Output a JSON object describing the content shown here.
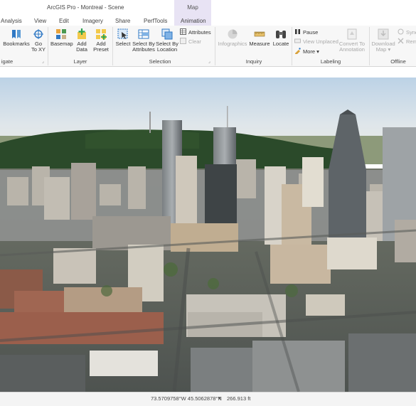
{
  "window": {
    "title": "ArcGIS Pro - Montreal - Scene"
  },
  "contextual_tab": {
    "group_label": "Map",
    "tab_label": "Animation"
  },
  "tabs": [
    "Analysis",
    "View",
    "Edit",
    "Imagery",
    "Share",
    "PerfTools"
  ],
  "ribbon": {
    "groups": {
      "navigate": "igate",
      "layer": "Layer",
      "selection": "Selection",
      "inquiry": "Inquiry",
      "labeling": "Labeling",
      "offline": "Offline"
    },
    "navigate": {
      "bookmarks": "Bookmarks",
      "go_to_xy_1": "Go",
      "go_to_xy_2": "To XY"
    },
    "layer": {
      "basemap": "Basemap",
      "add_data_1": "Add",
      "add_data_2": "Data",
      "add_preset_1": "Add",
      "add_preset_2": "Preset"
    },
    "selection": {
      "select": "Select",
      "select_by_attr_1": "Select By",
      "select_by_attr_2": "Attributes",
      "select_by_loc_1": "Select By",
      "select_by_loc_2": "Location",
      "attributes": "Attributes",
      "clear": "Clear"
    },
    "inquiry": {
      "infographics": "Infographics",
      "measure": "Measure",
      "locate": "Locate"
    },
    "labeling": {
      "pause": "Pause",
      "view_unplaced": "View Unplaced",
      "more": "More",
      "convert_1": "Convert To",
      "convert_2": "Annotation"
    },
    "offline": {
      "download_1": "Download",
      "download_2": "Map",
      "sync": "Sync",
      "remove": "Rem"
    }
  },
  "status_bar": {
    "coordinates": "73.5709758°W 45.5062878°N",
    "elevation": "266.913 ft"
  },
  "icons": {
    "bookmarks": "bookmarks-icon",
    "go_to_xy": "go-to-xy-icon",
    "basemap": "basemap-icon",
    "add_data": "add-data-icon",
    "add_preset": "add-preset-icon",
    "select": "select-icon",
    "select_by_attributes": "select-by-attributes-icon",
    "select_by_location": "select-by-location-icon",
    "attributes": "attributes-icon",
    "clear": "clear-icon",
    "infographics": "infographics-icon",
    "measure": "measure-icon",
    "locate": "locate-icon",
    "pause": "pause-icon",
    "view_unplaced": "view-unplaced-icon",
    "more": "more-icon",
    "convert": "convert-annotation-icon",
    "download_map": "download-map-icon",
    "sync": "sync-icon",
    "remove": "remove-icon"
  },
  "colors": {
    "accent": "#1f6fb2",
    "contextual_tab": "#e8e3f4",
    "sky_top": "#c8d9ea",
    "mountain": "#2b4a2a"
  }
}
